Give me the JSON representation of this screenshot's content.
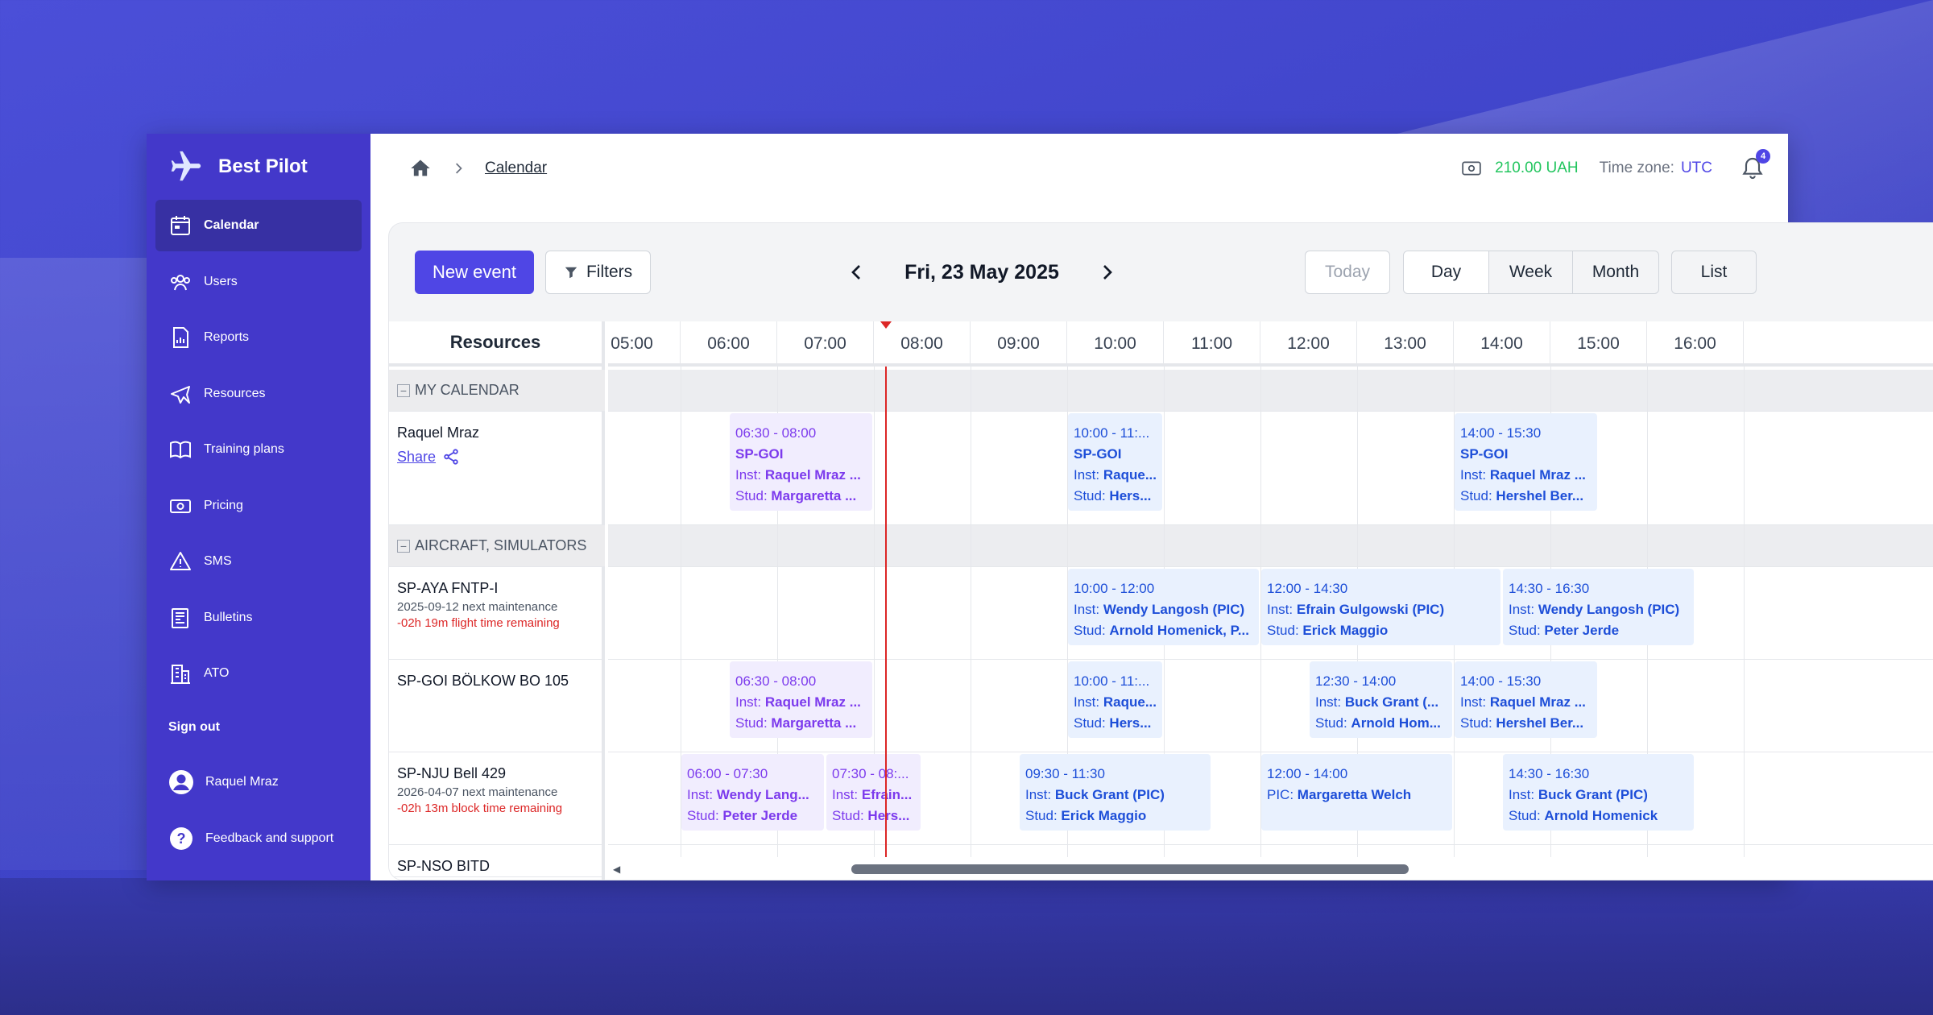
{
  "app": {
    "brand": "Best Pilot",
    "accent_color": "#4338ca",
    "sidebar": {
      "items": [
        {
          "label": "Calendar",
          "icon": "calendar-icon",
          "active": true
        },
        {
          "label": "Users",
          "icon": "users-icon"
        },
        {
          "label": "Reports",
          "icon": "report-icon"
        },
        {
          "label": "Resources",
          "icon": "airplane-icon"
        },
        {
          "label": "Training plans",
          "icon": "book-icon"
        },
        {
          "label": "Pricing",
          "icon": "money-icon"
        },
        {
          "label": "SMS",
          "icon": "warning-icon"
        },
        {
          "label": "Bulletins",
          "icon": "newspaper-icon"
        },
        {
          "label": "ATO",
          "icon": "building-icon"
        }
      ],
      "sign_out": "Sign out",
      "user_name": "Raquel Mraz",
      "feedback": "Feedback and support"
    }
  },
  "topbar": {
    "breadcrumb": "Calendar",
    "balance": "210.00 UAH",
    "timezone_label": "Time zone:",
    "timezone_value": "UTC",
    "notification_count": "4"
  },
  "toolbar": {
    "new_event": "New event",
    "filters": "Filters",
    "date": "Fri, 23 May 2025",
    "today": "Today",
    "views": [
      "Day",
      "Week",
      "Month"
    ],
    "active_view": "Day",
    "list": "List"
  },
  "grid": {
    "resources_header": "Resources",
    "hours": [
      "05:00",
      "06:00",
      "07:00",
      "08:00",
      "09:00",
      "10:00",
      "11:00",
      "12:00",
      "13:00",
      "14:00",
      "15:00",
      "16:00"
    ],
    "now_time": "08:07",
    "rows": [
      {
        "type": "group",
        "label": "MY CALENDAR"
      },
      {
        "type": "resource",
        "name": "Raquel Mraz",
        "share": "Share",
        "events": [
          {
            "start": "06:30",
            "end": "08:00",
            "color": "purple",
            "lines": [
              "06:30 - 08:00",
              "SP-GOI",
              "Inst: |Raquel Mraz ...",
              "Stud: |Margaretta ..."
            ]
          },
          {
            "start": "10:00",
            "end": "11:00",
            "color": "blue",
            "lines": [
              "10:00 - 11:...",
              "SP-GOI",
              "Inst: |Raque...",
              "Stud: |Hers..."
            ]
          },
          {
            "start": "14:00",
            "end": "15:30",
            "color": "blue",
            "lines": [
              "14:00 - 15:30",
              "SP-GOI",
              "Inst: |Raquel Mraz ...",
              "Stud: |Hershel Ber..."
            ]
          }
        ]
      },
      {
        "type": "group",
        "label": "AIRCRAFT, SIMULATORS"
      },
      {
        "type": "resource",
        "name": "SP-AYA FNTP-I",
        "sub": "2025-09-12 next maintenance",
        "warn": "-02h 19m flight time remaining",
        "events": [
          {
            "start": "10:00",
            "end": "12:00",
            "color": "blue",
            "lines": [
              "10:00 - 12:00",
              "Inst: |Wendy Langosh (PIC)",
              "Stud: |Arnold Homenick, P..."
            ]
          },
          {
            "start": "12:00",
            "end": "14:30",
            "color": "blue",
            "lines": [
              "12:00 - 14:30",
              "Inst: |Efrain Gulgowski (PIC)",
              "Stud: |Erick Maggio"
            ]
          },
          {
            "start": "14:30",
            "end": "16:30",
            "color": "blue",
            "lines": [
              "14:30 - 16:30",
              "Inst: |Wendy Langosh (PIC)",
              "Stud: |Peter Jerde"
            ]
          }
        ]
      },
      {
        "type": "resource",
        "name": "SP-GOI BÖLKOW BO 105",
        "events": [
          {
            "start": "06:30",
            "end": "08:00",
            "color": "purple",
            "lines": [
              "06:30 - 08:00",
              "Inst: |Raquel Mraz ...",
              "Stud: |Margaretta ..."
            ]
          },
          {
            "start": "10:00",
            "end": "11:00",
            "color": "blue",
            "lines": [
              "10:00 - 11:...",
              "Inst: |Raque...",
              "Stud: |Hers..."
            ]
          },
          {
            "start": "12:30",
            "end": "14:00",
            "color": "blue",
            "lines": [
              "12:30 - 14:00",
              "Inst: |Buck Grant (...",
              "Stud: |Arnold Hom..."
            ]
          },
          {
            "start": "14:00",
            "end": "15:30",
            "color": "blue",
            "lines": [
              "14:00 - 15:30",
              "Inst: |Raquel Mraz ...",
              "Stud: |Hershel Ber..."
            ]
          }
        ]
      },
      {
        "type": "resource",
        "name": "SP-NJU Bell 429",
        "sub": "2026-04-07 next maintenance",
        "warn": "-02h 13m block time remaining",
        "events": [
          {
            "start": "06:00",
            "end": "07:30",
            "color": "purple",
            "lines": [
              "06:00 - 07:30",
              "Inst: |Wendy Lang...",
              "Stud: |Peter Jerde"
            ]
          },
          {
            "start": "07:30",
            "end": "08:30",
            "color": "purple",
            "lines": [
              "07:30 - 08:...",
              "Inst: |Efrain...",
              "Stud: |Hers..."
            ]
          },
          {
            "start": "09:30",
            "end": "11:30",
            "color": "blue",
            "lines": [
              "09:30 - 11:30",
              "Inst: |Buck Grant (PIC)",
              "Stud: |Erick Maggio"
            ]
          },
          {
            "start": "12:00",
            "end": "14:00",
            "color": "blue",
            "lines": [
              "12:00 - 14:00",
              "PIC: |Margaretta Welch"
            ]
          },
          {
            "start": "14:30",
            "end": "16:30",
            "color": "blue",
            "lines": [
              "14:30 - 16:30",
              "Inst: |Buck Grant (PIC)",
              "Stud: |Arnold Homenick"
            ]
          }
        ]
      },
      {
        "type": "resource",
        "name": "SP-NSO BITD",
        "events": []
      }
    ]
  },
  "colors": {
    "event_purple_bg": "#f1edfe",
    "event_purple_text": "#7c3aed",
    "event_blue_bg": "#e9f1fe",
    "event_blue_text": "#1d4ed8",
    "now_line": "#dc2626",
    "balance": "#22c55e"
  }
}
